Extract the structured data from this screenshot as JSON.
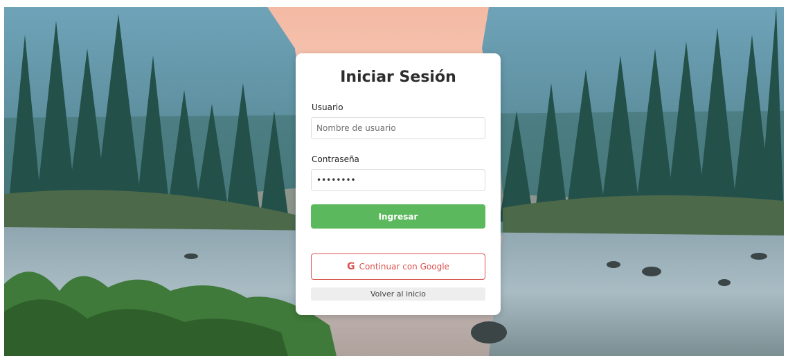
{
  "login": {
    "title": "Iniciar Sesión",
    "username_label": "Usuario",
    "username_placeholder": "Nombre de usuario",
    "password_label": "Contraseña",
    "password_value": "12345678",
    "submit_label": "Ingresar",
    "google_label": "Continuar con Google",
    "back_label": "Volver al inicio"
  },
  "colors": {
    "primary": "#5cb85c",
    "google": "#d9534f",
    "back_bg": "#eeeeee"
  },
  "icons": {
    "google": "google-icon"
  }
}
